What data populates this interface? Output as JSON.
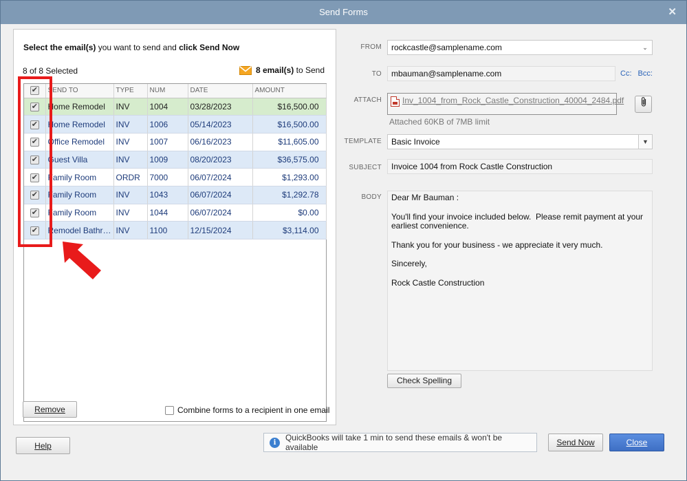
{
  "window": {
    "title": "Send Forms",
    "close_glyph": "✕"
  },
  "left": {
    "instruction_bold1": "Select the email(s)",
    "instruction_mid": " you want to send and ",
    "instruction_bold2": "click Send Now",
    "selected_count": "8 of 8 Selected",
    "emails_count": "8 email(s)",
    "emails_suffix": " to Send",
    "columns": [
      "SEND TO",
      "TYPE",
      "NUM",
      "DATE",
      "AMOUNT"
    ],
    "rows": [
      {
        "send_to": "Home Remodel",
        "type": "INV",
        "num": "1004",
        "date": "03/28/2023",
        "amount": "$16,500.00"
      },
      {
        "send_to": "Home Remodel",
        "type": "INV",
        "num": "1006",
        "date": "05/14/2023",
        "amount": "$16,500.00"
      },
      {
        "send_to": "Office Remodel",
        "type": "INV",
        "num": "1007",
        "date": "06/16/2023",
        "amount": "$11,605.00"
      },
      {
        "send_to": "Guest Villa",
        "type": "INV",
        "num": "1009",
        "date": "08/20/2023",
        "amount": "$36,575.00"
      },
      {
        "send_to": "Family Room",
        "type": "ORDR",
        "num": "7000",
        "date": "06/07/2024",
        "amount": "$1,293.00"
      },
      {
        "send_to": "Family Room",
        "type": "INV",
        "num": "1043",
        "date": "06/07/2024",
        "amount": "$1,292.78"
      },
      {
        "send_to": "Family Room",
        "type": "INV",
        "num": "1044",
        "date": "06/07/2024",
        "amount": "$0.00"
      },
      {
        "send_to": "Remodel Bathr…",
        "type": "INV",
        "num": "1100",
        "date": "12/15/2024",
        "amount": "$3,114.00"
      }
    ],
    "remove_label": "Remove",
    "combine_label": "Combine forms to a recipient in one email"
  },
  "form": {
    "from_label": "FROM",
    "from_value": "rockcastle@samplename.com",
    "to_label": "TO",
    "to_value": "mbauman@samplename.com",
    "cc_label": "Cc:",
    "bcc_label": "Bcc:",
    "attach_label": "ATTACH",
    "attach_file": "Inv_1004_from_Rock_Castle_Construction_40004_2484.pdf",
    "attach_note": "Attached 60KB of 7MB limit",
    "template_label": "TEMPLATE",
    "template_value": "Basic Invoice",
    "subject_label": "SUBJECT",
    "subject_value": "Invoice 1004 from Rock Castle Construction",
    "body_label": "BODY",
    "body_greeting": "Dear Mr Bauman :",
    "body_p1": "You'll find your invoice included below.  Please remit payment at your earliest convenience.",
    "body_p2": "Thank you for your business - we appreciate it very much.",
    "body_p3": "Sincerely,",
    "body_p4": "Rock Castle Construction",
    "spell_label": "Check Spelling"
  },
  "footer": {
    "help_label": "Help",
    "info_text": "QuickBooks will take 1 min to send these emails & won't be available",
    "send_label": "Send Now",
    "close_label": "Close"
  },
  "colors": {
    "title_bar": "#7f9ab5",
    "annotation_red": "#e81b1b",
    "close_button": "#4a7bd0"
  }
}
